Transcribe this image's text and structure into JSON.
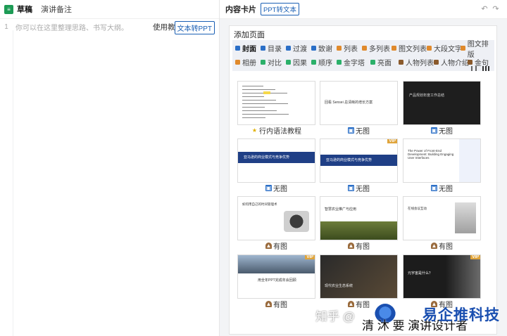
{
  "left": {
    "tabs": [
      "草稿",
      "演讲备注"
    ],
    "line_number": "1",
    "placeholder": "你可以在这里整理思路、书写大纲。",
    "tutorial_label": "使用教程",
    "to_ppt_label": "文本转PPT"
  },
  "right": {
    "title": "内容卡片",
    "ppt_to_text_label": "PPT转文本",
    "add_page_title": "添加页面",
    "filters": [
      {
        "label": "封面",
        "color": "#2b6fc7",
        "active": true
      },
      {
        "label": "目录",
        "color": "#2b6fc7"
      },
      {
        "label": "过渡",
        "color": "#2b6fc7"
      },
      {
        "label": "致谢",
        "color": "#2b6fc7"
      },
      {
        "label": "列表",
        "color": "#e08a2c"
      },
      {
        "label": "多列表",
        "color": "#e08a2c"
      },
      {
        "label": "图文列表",
        "color": "#e08a2c"
      },
      {
        "label": "大段文字",
        "color": "#e08a2c"
      },
      {
        "label": "图文排版",
        "color": "#e08a2c"
      },
      {
        "label": "相册",
        "color": "#e08a2c"
      },
      {
        "label": "对比",
        "color": "#2bb06a"
      },
      {
        "label": "因果",
        "color": "#2bb06a"
      },
      {
        "label": "顺序",
        "color": "#2bb06a"
      },
      {
        "label": "金字塔",
        "color": "#2bb06a"
      },
      {
        "label": "亮面",
        "color": "#2bb06a"
      },
      {
        "label": "人物列表",
        "color": "#8a5a2c"
      },
      {
        "label": "人物介绍",
        "color": "#8a5a2c"
      },
      {
        "label": "金句",
        "color": "#8a5a2c"
      }
    ],
    "cards": [
      {
        "label": "行内语法教程",
        "icon": "star-icon",
        "style": "doc"
      },
      {
        "label": "无图",
        "icon": "image-icon",
        "style": "white",
        "text": "回看 Sensei 总清晰的增长方案"
      },
      {
        "label": "无图",
        "icon": "image-icon",
        "style": "dark",
        "text": "产品规划年度工作总结"
      },
      {
        "label": "无图",
        "icon": "image-icon",
        "style": "blueband",
        "text": "亚马逊的商业模式与竞争优势"
      },
      {
        "label": "无图",
        "icon": "image-icon",
        "style": "blueband2",
        "vip": "VIP",
        "text": "亚马逊的商业模式与竞争优势"
      },
      {
        "label": "无图",
        "icon": "image-icon",
        "style": "frontend",
        "text": "The Power of Front-End Development: Building Engaging User Interfaces"
      },
      {
        "label": "有图",
        "icon": "mountain-icon",
        "style": "photo-right",
        "text": "如何用自己的时间管理术"
      },
      {
        "label": "有图",
        "icon": "mountain-icon",
        "style": "field",
        "text": "智慧农业推广与应用"
      },
      {
        "label": "有图",
        "icon": "mountain-icon",
        "style": "device",
        "text": "在线会议互动"
      },
      {
        "label": "有图",
        "icon": "mountain-icon",
        "style": "city",
        "vip": "VIP",
        "text": "用全年PPT完成年会回顾"
      },
      {
        "label": "有图",
        "icon": "mountain-icon",
        "style": "dark-field",
        "text": "现代农业生态系统"
      },
      {
        "label": "有图",
        "icon": "mountain-icon",
        "style": "dark-robot",
        "vip": "VIP",
        "text": "元宇宙是什么？"
      }
    ]
  },
  "watermark": {
    "zhihu": "知乎 @",
    "author": "清 沐 要 演讲设计者",
    "brand": "易企推科技"
  }
}
